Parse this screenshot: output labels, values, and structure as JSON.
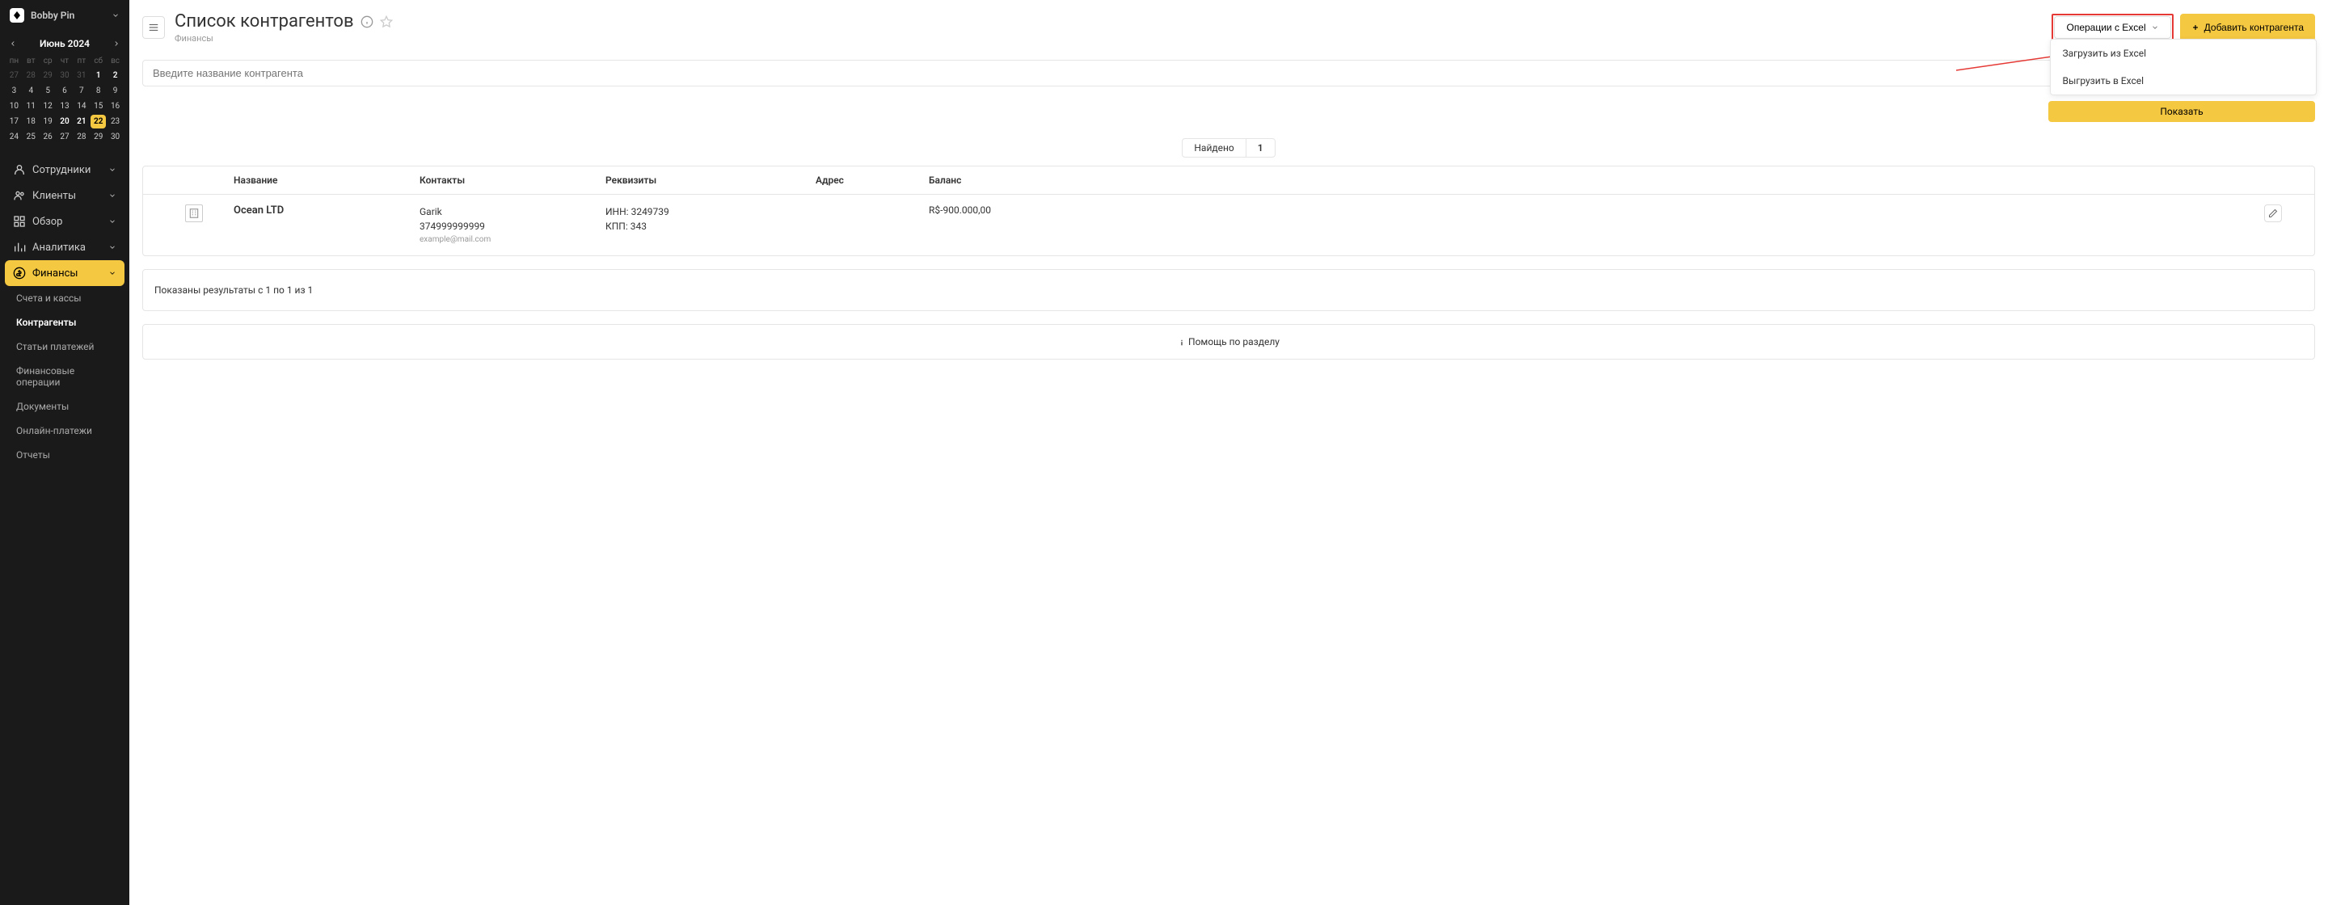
{
  "user": {
    "name": "Bobby Pin"
  },
  "calendar": {
    "title": "Июнь 2024",
    "dow": [
      "пн",
      "вт",
      "ср",
      "чт",
      "пт",
      "сб",
      "вс"
    ],
    "days": [
      {
        "n": "27",
        "muted": true
      },
      {
        "n": "28",
        "muted": true
      },
      {
        "n": "29",
        "muted": true
      },
      {
        "n": "30",
        "muted": true
      },
      {
        "n": "31",
        "muted": true
      },
      {
        "n": "1",
        "bold": true
      },
      {
        "n": "2",
        "bold": true
      },
      {
        "n": "3"
      },
      {
        "n": "4"
      },
      {
        "n": "5"
      },
      {
        "n": "6"
      },
      {
        "n": "7"
      },
      {
        "n": "8"
      },
      {
        "n": "9"
      },
      {
        "n": "10"
      },
      {
        "n": "11"
      },
      {
        "n": "12"
      },
      {
        "n": "13"
      },
      {
        "n": "14"
      },
      {
        "n": "15"
      },
      {
        "n": "16"
      },
      {
        "n": "17"
      },
      {
        "n": "18"
      },
      {
        "n": "19"
      },
      {
        "n": "20",
        "bold": true
      },
      {
        "n": "21",
        "bold": true
      },
      {
        "n": "22",
        "today": true
      },
      {
        "n": "23"
      },
      {
        "n": "24"
      },
      {
        "n": "25"
      },
      {
        "n": "26"
      },
      {
        "n": "27"
      },
      {
        "n": "28"
      },
      {
        "n": "29"
      },
      {
        "n": "30"
      }
    ]
  },
  "nav": {
    "items": [
      {
        "label": "Сотрудники",
        "icon": "user"
      },
      {
        "label": "Клиенты",
        "icon": "users"
      },
      {
        "label": "Обзор",
        "icon": "grid"
      },
      {
        "label": "Аналитика",
        "icon": "chart"
      },
      {
        "label": "Финансы",
        "icon": "dollar",
        "active": true
      }
    ],
    "subs": [
      {
        "label": "Счета и кассы"
      },
      {
        "label": "Контрагенты",
        "current": true
      },
      {
        "label": "Статьи платежей"
      },
      {
        "label": "Финансовые операции"
      },
      {
        "label": "Документы"
      },
      {
        "label": "Онлайн-платежи"
      },
      {
        "label": "Отчеты"
      }
    ]
  },
  "page": {
    "title": "Список контрагентов",
    "breadcrumb": "Финансы",
    "excel_btn": "Операции с Excel",
    "add_btn": "Добавить контрагента",
    "dropdown": {
      "import": "Загрузить из Excel",
      "export": "Выгрузить в Excel"
    },
    "search_placeholder": "Введите название контрагента",
    "show_btn": "Показать",
    "found_label": "Найдено",
    "found_count": "1",
    "columns": {
      "name": "Название",
      "contacts": "Контакты",
      "req": "Реквизиты",
      "addr": "Адрес",
      "balance": "Баланс"
    },
    "row": {
      "name": "Ocean LTD",
      "contact_name": "Garik",
      "contact_phone": "374999999999",
      "contact_email": "example@mail.com",
      "inn_label": "ИНН:",
      "inn": "3249739",
      "kpp_label": "КПП:",
      "kpp": "343",
      "balance": "R$-900.000,00"
    },
    "results_text": "Показаны результаты с 1 по 1 из 1",
    "help_text": "Помощь по разделу"
  }
}
